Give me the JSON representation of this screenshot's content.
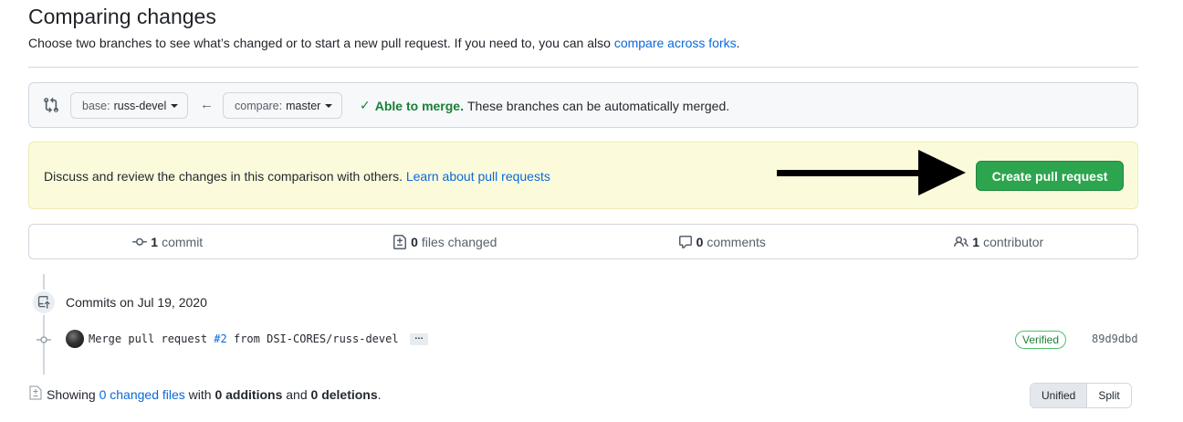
{
  "header": {
    "title": "Comparing changes",
    "subtitle": "Choose two branches to see what’s changed or to start a new pull request. If you need to, you can also",
    "forks_link": "compare across forks",
    "subtitle_end": "."
  },
  "range": {
    "base_label": "base:",
    "base_branch": "russ-devel",
    "compare_label": "compare:",
    "compare_branch": "master",
    "merge_status": "Able to merge.",
    "merge_desc": "These branches can be automatically merged."
  },
  "flash": {
    "message": "Discuss and review the changes in this comparison with others.",
    "link": "Learn about pull requests",
    "button": "Create pull request"
  },
  "summary": {
    "commits_count": "1",
    "commits_label": "commit",
    "files_count": "0",
    "files_label": "files changed",
    "comments_count": "0",
    "comments_label": "comments",
    "contributors_count": "1",
    "contributors_label": "contributor"
  },
  "commits": {
    "date_heading": "Commits on Jul 19, 2020",
    "items": [
      {
        "msg_prefix": "Merge pull request",
        "pr_ref": "#2",
        "msg_suffix": "from DSI-CORES/russ-devel",
        "ellipsis": "…",
        "verified": "Verified",
        "sha": "89d9dbd"
      }
    ]
  },
  "toc": {
    "showing": "Showing",
    "changed_files": "0 changed files",
    "with": "with",
    "additions": "0 additions",
    "and": "and",
    "deletions": "0 deletions",
    "end": "."
  },
  "diff_view": {
    "unified": "Unified",
    "split": "Split"
  },
  "colors": {
    "accent_link": "#0969da",
    "success": "#1a7f37",
    "button_green": "#2da44e",
    "flash_bg": "#fbfbdc"
  }
}
